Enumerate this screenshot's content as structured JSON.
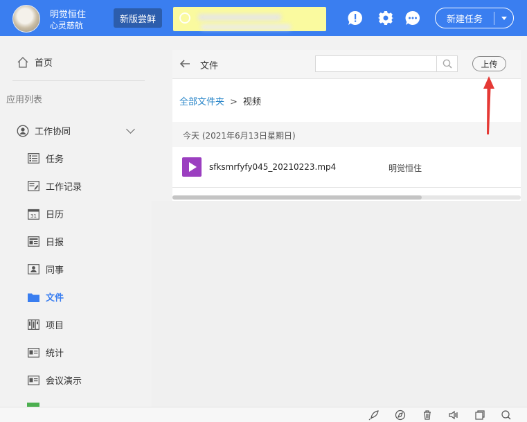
{
  "header": {
    "user_name": "明觉恒住",
    "user_motto": "心灵慈航",
    "new_version_label": "新版尝鲜",
    "new_task_label": "新建任务",
    "icons": [
      "alert-icon",
      "gear-icon",
      "chat-icon"
    ]
  },
  "sidebar": {
    "home_label": "首页",
    "app_list_label": "应用列表",
    "group_label": "工作协同",
    "items": [
      {
        "label": "任务",
        "icon": "task-list-icon"
      },
      {
        "label": "工作记录",
        "icon": "work-record-icon"
      },
      {
        "label": "日历",
        "icon": "calendar-icon"
      },
      {
        "label": "日报",
        "icon": "daily-report-icon"
      },
      {
        "label": "同事",
        "icon": "colleague-icon"
      },
      {
        "label": "文件",
        "icon": "folder-icon",
        "active": true
      },
      {
        "label": "项目",
        "icon": "project-icon"
      },
      {
        "label": "统计",
        "icon": "stats-icon"
      },
      {
        "label": "会议演示",
        "icon": "meeting-icon"
      }
    ]
  },
  "panel": {
    "title": "文件",
    "upload_label": "上传",
    "breadcrumb": {
      "root": "全部文件夹",
      "separator": ">",
      "current": "视频"
    },
    "day_label": "今天 (2021年6月13日星期日)",
    "files": [
      {
        "name": "sfksmrfyfy045_20210223.mp4",
        "owner": "明觉恒住",
        "icon": "video-file-icon"
      }
    ]
  },
  "colors": {
    "accent": "#3a7ef0",
    "link": "#2a86c9",
    "video": "#9b3fc0",
    "annotation": "#e53935"
  }
}
